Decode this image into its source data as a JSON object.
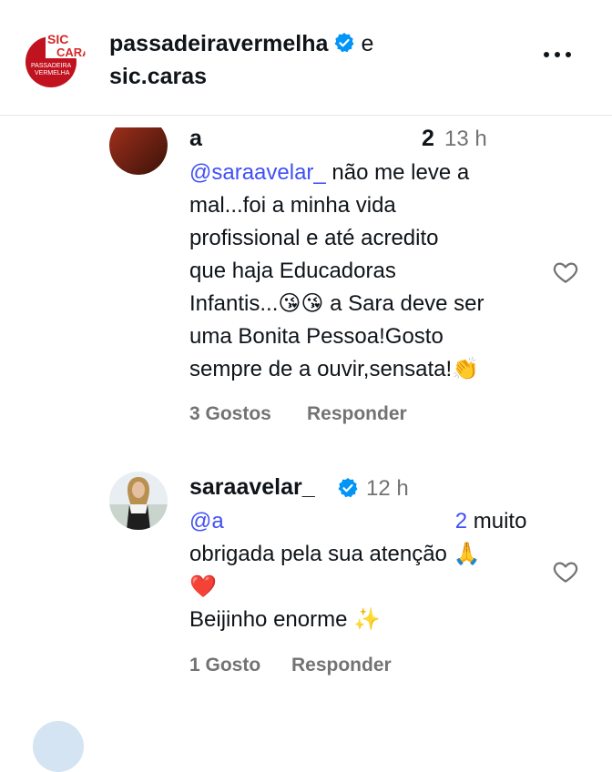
{
  "header": {
    "account_1": "passadeiravermelha",
    "conjunction": "e",
    "account_2": "sic.caras",
    "logo_text_top": "SIC CARAS",
    "logo_text_bottom": "PASSADEIRA VERMELHA"
  },
  "comment_1": {
    "username_partial": "a",
    "username_tail": "2",
    "time": "13 h",
    "mention": "@saraavelar_",
    "lines": [
      " não me leve a",
      "mal...foi a minha vida",
      "profissional e até acredito",
      "que haja Educadoras",
      "Infantis...😘😘 a Sara deve ser",
      "uma Bonita Pessoa!Gosto",
      "sempre de a ouvir,sensata!👏"
    ],
    "likes": "3 Gostos",
    "reply": "Responder"
  },
  "comment_2": {
    "username": "saraavelar_",
    "time": "12 h",
    "mention_start": "@a",
    "mention_end": "2",
    "lines": [
      " muito",
      "obrigada pela sua atenção 🙏",
      "❤️",
      "Beijinho enorme ✨"
    ],
    "likes": "1 Gosto",
    "reply": "Responder"
  },
  "colors": {
    "mention": "#4150f7",
    "muted": "#737373",
    "verified": "#0095f6"
  }
}
